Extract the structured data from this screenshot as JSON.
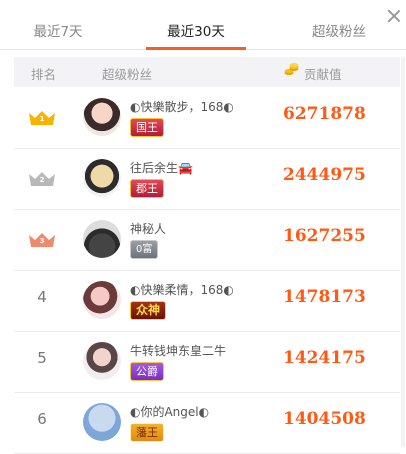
{
  "tabs": [
    {
      "label": "最近7天"
    },
    {
      "label": "最近30天"
    },
    {
      "label": "超级粉丝"
    }
  ],
  "active_tab_index": 1,
  "header": {
    "rank": "排名",
    "fans": "超级粉丝",
    "contrib": "贡献值"
  },
  "rows": [
    {
      "rank": "1",
      "name": "◐快樂散步，168◐",
      "badge": "国王",
      "value": "6271878"
    },
    {
      "rank": "2",
      "name": "往后余生🚘",
      "badge": "郡王",
      "value": "2444975"
    },
    {
      "rank": "3",
      "name": "神秘人",
      "badge": "0富",
      "value": "1627255"
    },
    {
      "rank": "4",
      "name": "◐快樂柔情，168◐",
      "badge": "众神",
      "value": "1478173"
    },
    {
      "rank": "5",
      "name": "牛转钱坤东皇二牛",
      "badge": "公爵",
      "value": "1424175"
    },
    {
      "rank": "6",
      "name": "◐你的Angel◐",
      "badge": "藩王",
      "value": "1404508"
    }
  ],
  "colors": {
    "accent": "#ff5a1f",
    "value": "#ff5a14",
    "gold_crown": "#f5b400",
    "silver_crown": "#b8b8b8",
    "bronze_crown": "#f08a6c"
  },
  "icons": {
    "close": "close-icon",
    "coin": "coin-stack-icon",
    "crown": "crown-icon"
  }
}
